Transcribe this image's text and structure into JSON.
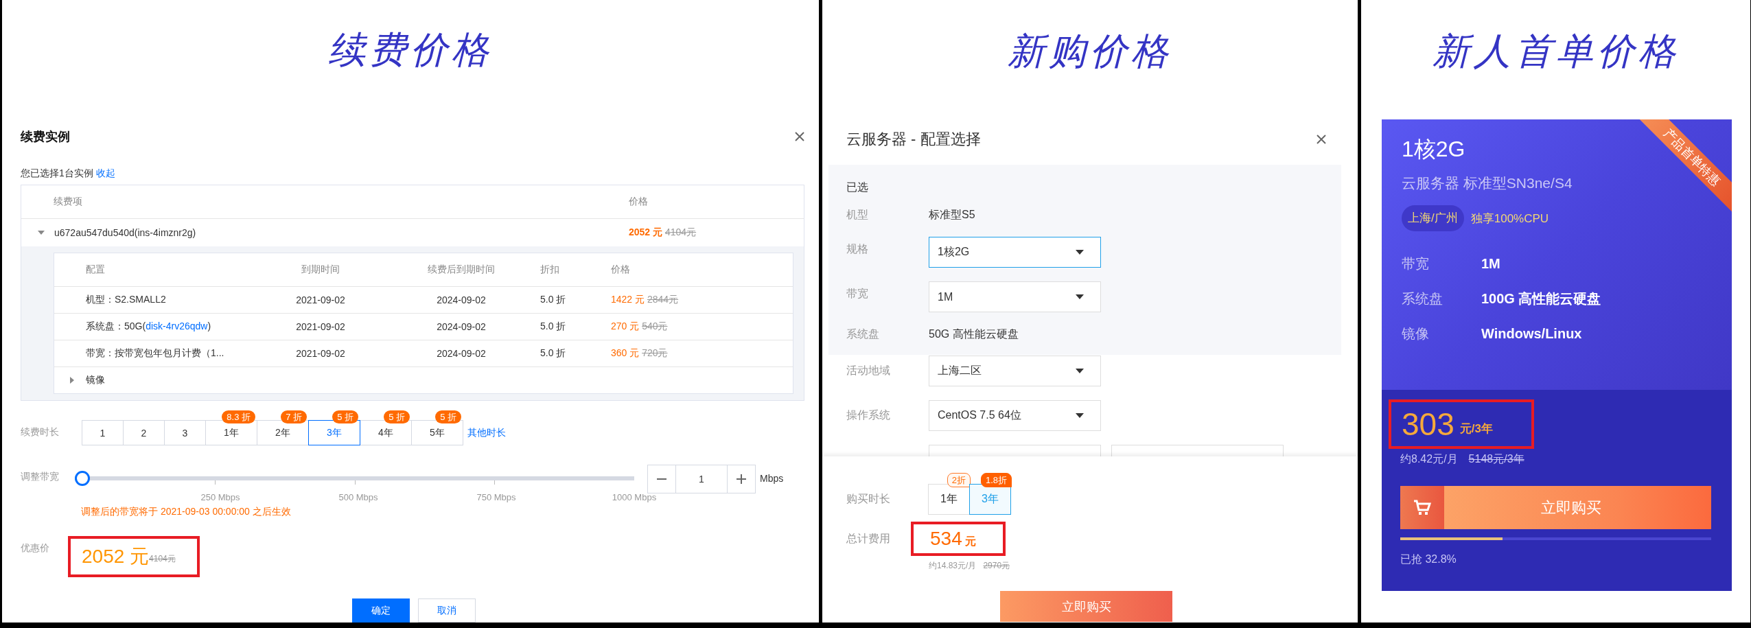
{
  "renewal_panel": {
    "heading": "续费价格",
    "dialog": {
      "title": "续费实例",
      "selection_note": "您已选择1台实例",
      "collapse_link": "收起",
      "table": {
        "columns": [
          "续费项",
          "价格"
        ],
        "instance": {
          "name": "u672au547du540d(ins-4imznr2g)",
          "expanded": true,
          "price": "2052 元",
          "original_price": "4104元",
          "detail_columns": [
            "配置",
            "到期时间",
            "续费后到期时间",
            "折扣",
            "价格"
          ],
          "detail_rows": [
            {
              "config": "机型：S2.SMALL2",
              "expiry": "2021-09-02",
              "renewed_expiry": "2024-09-02",
              "discount": "5.0 折",
              "price": "1422 元",
              "original_price": "2844元"
            },
            {
              "config": "系统盘：50G(",
              "config_link": "disk-4rv26qdw",
              "config_after": ")",
              "expiry": "2021-09-02",
              "renewed_expiry": "2024-09-02",
              "discount": "5.0 折",
              "price": "270 元",
              "original_price": "540元"
            },
            {
              "config": "带宽：按带宽包年包月计费（1...",
              "expiry": "2021-09-02",
              "renewed_expiry": "2024-09-02",
              "discount": "5.0 折",
              "price": "360 元",
              "original_price": "720元"
            }
          ],
          "sub_items": [
            {
              "label": "镜像",
              "expanded": false
            }
          ]
        }
      },
      "duration": {
        "label": "续费时长",
        "options": [
          {
            "label": "1",
            "selected": false
          },
          {
            "label": "2",
            "selected": false
          },
          {
            "label": "3",
            "selected": false
          },
          {
            "label": "1年",
            "badge": "8.3 折",
            "selected": false
          },
          {
            "label": "2年",
            "badge": "7 折",
            "selected": false
          },
          {
            "label": "3年",
            "badge": "5 折",
            "selected": true
          },
          {
            "label": "4年",
            "badge": "5 折",
            "selected": false
          },
          {
            "label": "5年",
            "badge": "5 折",
            "selected": false
          }
        ],
        "other_link": "其他时长"
      },
      "bandwidth": {
        "label": "调整带宽",
        "level": 0,
        "ticks": [
          "250 Mbps",
          "500 Mbps",
          "750 Mbps",
          "1000 Mbps"
        ],
        "value": "1",
        "unit": "Mbps",
        "notice": "调整后的带宽将于 2021-09-03 00:00:00 之后生效"
      },
      "offer": {
        "label": "优惠价",
        "amount": "2052 元",
        "original": "4104元",
        "highlighted": true
      },
      "buttons": [
        {
          "label": "确定",
          "kind": "primary"
        },
        {
          "label": "取消",
          "kind": "secondary"
        }
      ]
    }
  },
  "new_purchase_panel": {
    "heading": "新购价格",
    "dialog": {
      "title": "云服务器 - 配置选择",
      "selected_section": {
        "title": "已选",
        "rows": [
          {
            "label": "机型",
            "kind": "text",
            "value": "标准型S5"
          },
          {
            "label": "规格",
            "kind": "select",
            "value": "1核2G",
            "focused": true
          },
          {
            "label": "带宽",
            "kind": "select",
            "value": "1M",
            "focused": false
          },
          {
            "label": "系统盘",
            "kind": "text",
            "value": "50G 高性能云硬盘"
          }
        ]
      },
      "rows": [
        {
          "label": "活动地域",
          "kind": "select",
          "value": "上海二区",
          "focused": false
        },
        {
          "label": "操作系统",
          "kind": "select",
          "value": "CentOS 7.5 64位",
          "focused": false
        }
      ],
      "duration": {
        "label": "购买时长",
        "options": [
          {
            "label": "1年",
            "badge": "2折",
            "selected": false
          },
          {
            "label": "3年",
            "badge": "1.8折",
            "selected": true
          }
        ]
      },
      "total": {
        "label": "总计费用",
        "amount": "534",
        "unit": "元",
        "highlighted": true,
        "monthly": "约14.83元/月",
        "original": "2970元"
      },
      "buy_button": "立即购买"
    }
  },
  "first_order_panel": {
    "heading": "新人首单价格",
    "card": {
      "title": "1核2G",
      "subtitle": "云服务器 标准型SN3ne/S4",
      "region_tag": "上海/广州",
      "feature": "独享100%CPU",
      "ribbon": "产品首单特惠",
      "specs": [
        {
          "label": "带宽",
          "value": "1M"
        },
        {
          "label": "系统盘",
          "value": "100G 高性能云硬盘"
        },
        {
          "label": "镜像",
          "value": "Windows/Linux"
        }
      ],
      "price": {
        "amount": "303",
        "unit": "元/3年",
        "highlighted": true,
        "monthly": "约8.42元/月",
        "original": "5148元/3年"
      },
      "buy_button": "立即购买",
      "sold": {
        "level": 0.328,
        "text": "已抢 32.8%"
      }
    }
  }
}
